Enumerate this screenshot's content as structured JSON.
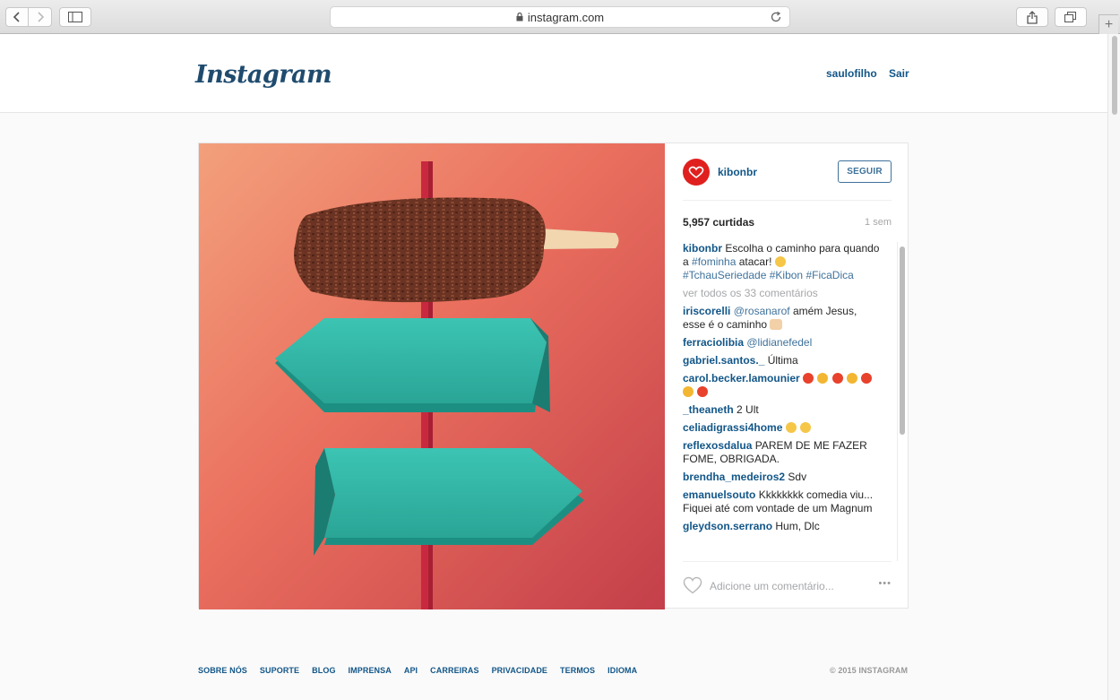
{
  "browser": {
    "url": "instagram.com"
  },
  "header": {
    "logo": "Instagram",
    "username": "saulofilho",
    "logout": "Sair"
  },
  "post": {
    "author": "kibonbr",
    "follow_label": "SEGUIR",
    "likes": "5,957 curtidas",
    "age": "1 sem",
    "caption": {
      "user": "kibonbr",
      "text": "Escolha o caminho para quando a",
      "tag1": "#fominha",
      "text2": "atacar!",
      "tags": "#TchauSeriedade #Kibon #FicaDica"
    },
    "view_all": "ver todos os 33 comentários",
    "comments": [
      {
        "user": "iriscorelli",
        "mention": "@rosanarof",
        "text": "amém Jesus, esse é o caminho"
      },
      {
        "user": "ferraciolibia",
        "mention": "@lidianefedel",
        "text": ""
      },
      {
        "user": "gabriel.santos._",
        "text": "Última"
      },
      {
        "user": "carol.becker.lamounier",
        "text": ""
      },
      {
        "user": "_theaneth",
        "text": "2 Ult"
      },
      {
        "user": "celiadigrassi4home",
        "text": ""
      },
      {
        "user": "reflexosdalua",
        "text": "PAREM DE ME FAZER FOME, OBRIGADA."
      },
      {
        "user": "brendha_medeiros2",
        "text": "Sdv"
      },
      {
        "user": "emanuelsouto",
        "text": "Kkkkkkkk comedia viu... Fiquei até com vontade de um Magnum"
      },
      {
        "user": "gleydson.serrano",
        "text": "Hum, Dlc"
      }
    ],
    "comment_placeholder": "Adicione um comentário...",
    "more": "•••"
  },
  "footer": {
    "links": [
      "SOBRE NÓS",
      "SUPORTE",
      "BLOG",
      "IMPRENSA",
      "API",
      "CARREIRAS",
      "PRIVACIDADE",
      "TERMOS",
      "IDIOMA"
    ],
    "copyright": "© 2015 INSTAGRAM"
  },
  "colors": {
    "link": "#125688",
    "follow": "#3f729b",
    "sign": "#2bb3a6",
    "background_photo": "#e8735f"
  }
}
